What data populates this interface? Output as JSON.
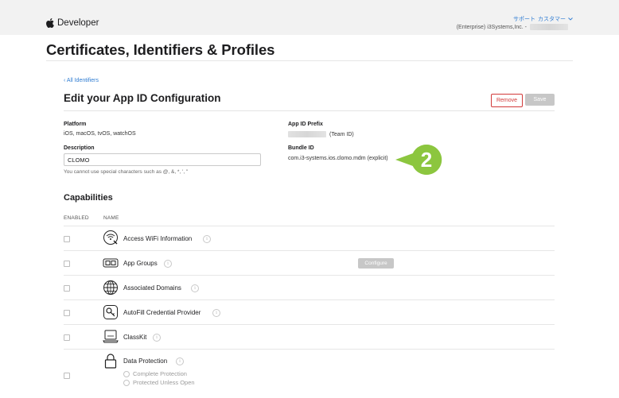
{
  "header": {
    "brand_name": "Developer",
    "support_label": "サポート",
    "customer_label": "カスタマー",
    "account_label": "(Enterprise) i3Systems,Inc. -"
  },
  "page": {
    "title": "Certificates, Identifiers & Profiles",
    "back_link": "‹ All Identifiers",
    "edit_title": "Edit your App ID Configuration",
    "remove_label": "Remove",
    "save_label": "Save"
  },
  "config": {
    "platform_label": "Platform",
    "platform_value": "iOS, macOS, tvOS, watchOS",
    "prefix_label": "App ID Prefix",
    "prefix_suffix": "(Team ID)",
    "description_label": "Description",
    "description_value": "CLOMO",
    "description_hint": "You cannot use special characters such as @, &, *, ', \"",
    "bundle_label": "Bundle ID",
    "bundle_value": "com.i3-systems.ios.clomo.mdm (explicit)"
  },
  "annotation": {
    "step_number": "2",
    "color": "#8cc63f"
  },
  "capabilities": {
    "title": "Capabilities",
    "col_enabled": "ENABLED",
    "col_name": "NAME",
    "configure_label": "Configure",
    "items": [
      {
        "name": "Access WiFi Information",
        "icon": "wifi-info-icon"
      },
      {
        "name": "App Groups",
        "icon": "app-groups-icon"
      },
      {
        "name": "Associated Domains",
        "icon": "globe-icon"
      },
      {
        "name": "AutoFill Credential Provider",
        "icon": "key-icon"
      },
      {
        "name": "ClassKit",
        "icon": "classkit-icon"
      },
      {
        "name": "Data Protection",
        "icon": "lock-icon"
      }
    ],
    "data_protection_options": [
      "Complete Protection",
      "Protected Unless Open"
    ]
  },
  "colors": {
    "link": "#2f7cd2",
    "remove": "#d23a3a",
    "disabled_button": "#c7c7c7"
  }
}
